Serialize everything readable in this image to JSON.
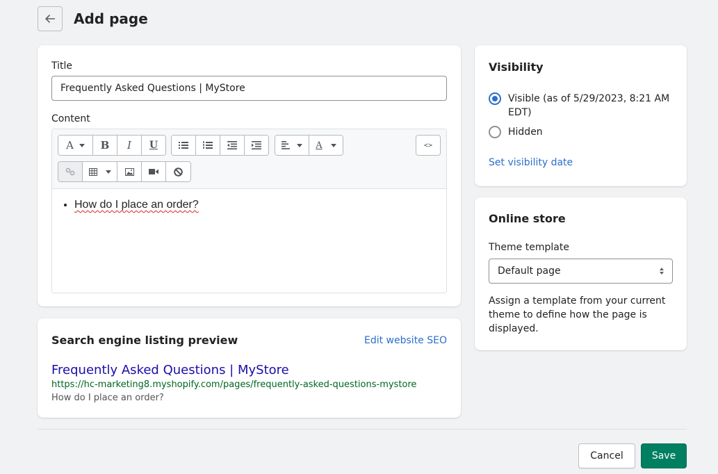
{
  "header": {
    "back_icon": "arrow-left-icon",
    "title": "Add page"
  },
  "main": {
    "title_label": "Title",
    "title_value": "Frequently Asked Questions | MyStore",
    "content_label": "Content",
    "toolbar": {
      "row1": [
        {
          "group": "text",
          "items": [
            {
              "name": "paragraph-format",
              "icon": "A",
              "dropdown": true
            },
            {
              "name": "bold",
              "icon": "B"
            },
            {
              "name": "italic",
              "icon": "I"
            },
            {
              "name": "underline",
              "icon": "U"
            }
          ]
        },
        {
          "group": "lists",
          "items": [
            {
              "name": "bullet-list",
              "icon": "bullet-list-icon"
            },
            {
              "name": "numbered-list",
              "icon": "numbered-list-icon"
            },
            {
              "name": "outdent",
              "icon": "outdent-icon"
            },
            {
              "name": "indent",
              "icon": "indent-icon"
            }
          ]
        },
        {
          "group": "align",
          "items": [
            {
              "name": "align",
              "icon": "align-left-icon",
              "dropdown": true
            },
            {
              "name": "text-color",
              "icon": "A",
              "dropdown": true
            }
          ]
        },
        {
          "group": "html",
          "items": [
            {
              "name": "show-html",
              "icon": "<>"
            }
          ]
        }
      ],
      "row2": [
        {
          "name": "link",
          "icon": "link-icon",
          "disabled": true
        },
        {
          "name": "table",
          "icon": "table-icon",
          "dropdown": true
        },
        {
          "name": "image",
          "icon": "image-icon"
        },
        {
          "name": "video",
          "icon": "video-icon"
        },
        {
          "name": "clear-formatting",
          "icon": "block-icon"
        }
      ]
    },
    "content_items": [
      "How do I place an order?"
    ]
  },
  "seo": {
    "heading": "Search engine listing preview",
    "edit_link": "Edit website SEO",
    "preview_title": "Frequently Asked Questions | MyStore",
    "preview_url": "https://hc-marketing8.myshopify.com/pages/frequently-asked-questions-mystore",
    "preview_description": "How do I place an order?"
  },
  "visibility": {
    "heading": "Visibility",
    "options": [
      {
        "label": "Visible (as of 5/29/2023, 8:21 AM EDT)",
        "checked": true
      },
      {
        "label": "Hidden",
        "checked": false
      }
    ],
    "set_date_link": "Set visibility date"
  },
  "online_store": {
    "heading": "Online store",
    "template_label": "Theme template",
    "template_value": "Default page",
    "help_text": "Assign a template from your current theme to define how the page is displayed."
  },
  "footer": {
    "cancel_label": "Cancel",
    "save_label": "Save"
  },
  "colors": {
    "primary": "#008060",
    "link": "#2c6ecb",
    "seo_title": "#1a0dab",
    "seo_url": "#006621"
  }
}
